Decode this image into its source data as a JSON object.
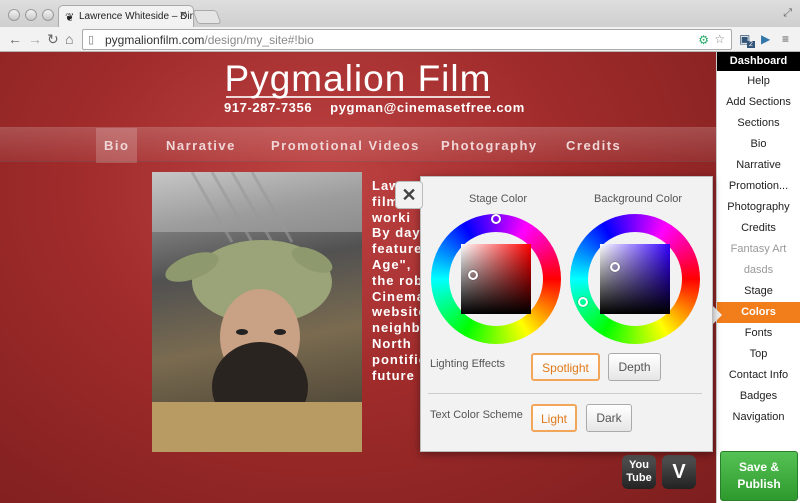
{
  "browser": {
    "tab_title": "Lawrence Whiteside – Dire",
    "url_host": "pygmalionfilm.com",
    "url_path": "/design/my_site#!bio",
    "extension_badge": "2"
  },
  "site": {
    "title": "Pygmalion Film",
    "phone": "917-287-7356",
    "email": "pygman@cinemasetfree.com",
    "menu": [
      "Bio",
      "Narrative",
      "Promotional Videos",
      "Photography",
      "Credits"
    ],
    "active_menu": "Bio",
    "bio_lines": [
      "Law",
      "film",
      "worki",
      "By day",
      "feature",
      "Age\",",
      "the rob",
      "Cinema",
      "website",
      "neighb",
      "North",
      "pontific",
      "future"
    ],
    "social": [
      "You Tube",
      "V"
    ]
  },
  "dashboard": {
    "title": "Dashboard",
    "items": [
      {
        "label": "Help",
        "state": "normal"
      },
      {
        "label": "Add Sections",
        "state": "normal"
      },
      {
        "label": "Sections",
        "state": "normal"
      },
      {
        "label": "Bio",
        "state": "normal"
      },
      {
        "label": "Narrative",
        "state": "normal"
      },
      {
        "label": "Promotion...",
        "state": "normal"
      },
      {
        "label": "Photography",
        "state": "normal"
      },
      {
        "label": "Credits",
        "state": "normal"
      },
      {
        "label": "Fantasy Art",
        "state": "dim"
      },
      {
        "label": "dasds",
        "state": "dim"
      },
      {
        "label": "Stage",
        "state": "normal"
      },
      {
        "label": "Colors",
        "state": "active"
      },
      {
        "label": "Fonts",
        "state": "normal"
      },
      {
        "label": "Top",
        "state": "normal"
      },
      {
        "label": "Contact Info",
        "state": "normal"
      },
      {
        "label": "Badges",
        "state": "normal"
      },
      {
        "label": "Navigation",
        "state": "normal"
      }
    ],
    "publish_line1": "Save &",
    "publish_line2": "Publish"
  },
  "color_panel": {
    "close": "✕",
    "stage_color_label": "Stage Color",
    "background_color_label": "Background Color",
    "stage_hue": "#ff0000",
    "background_hue": "#3300ff",
    "lighting_label": "Lighting Effects",
    "lighting_options": [
      "Spotlight",
      "Depth"
    ],
    "lighting_selected": "Spotlight",
    "text_scheme_label": "Text Color Scheme",
    "text_scheme_options": [
      "Light",
      "Dark"
    ],
    "text_scheme_selected": "Light"
  },
  "colors": {
    "accent": "#f27d1b",
    "stage_red": "#a02b2b",
    "publish_green": "#3aa83a"
  }
}
